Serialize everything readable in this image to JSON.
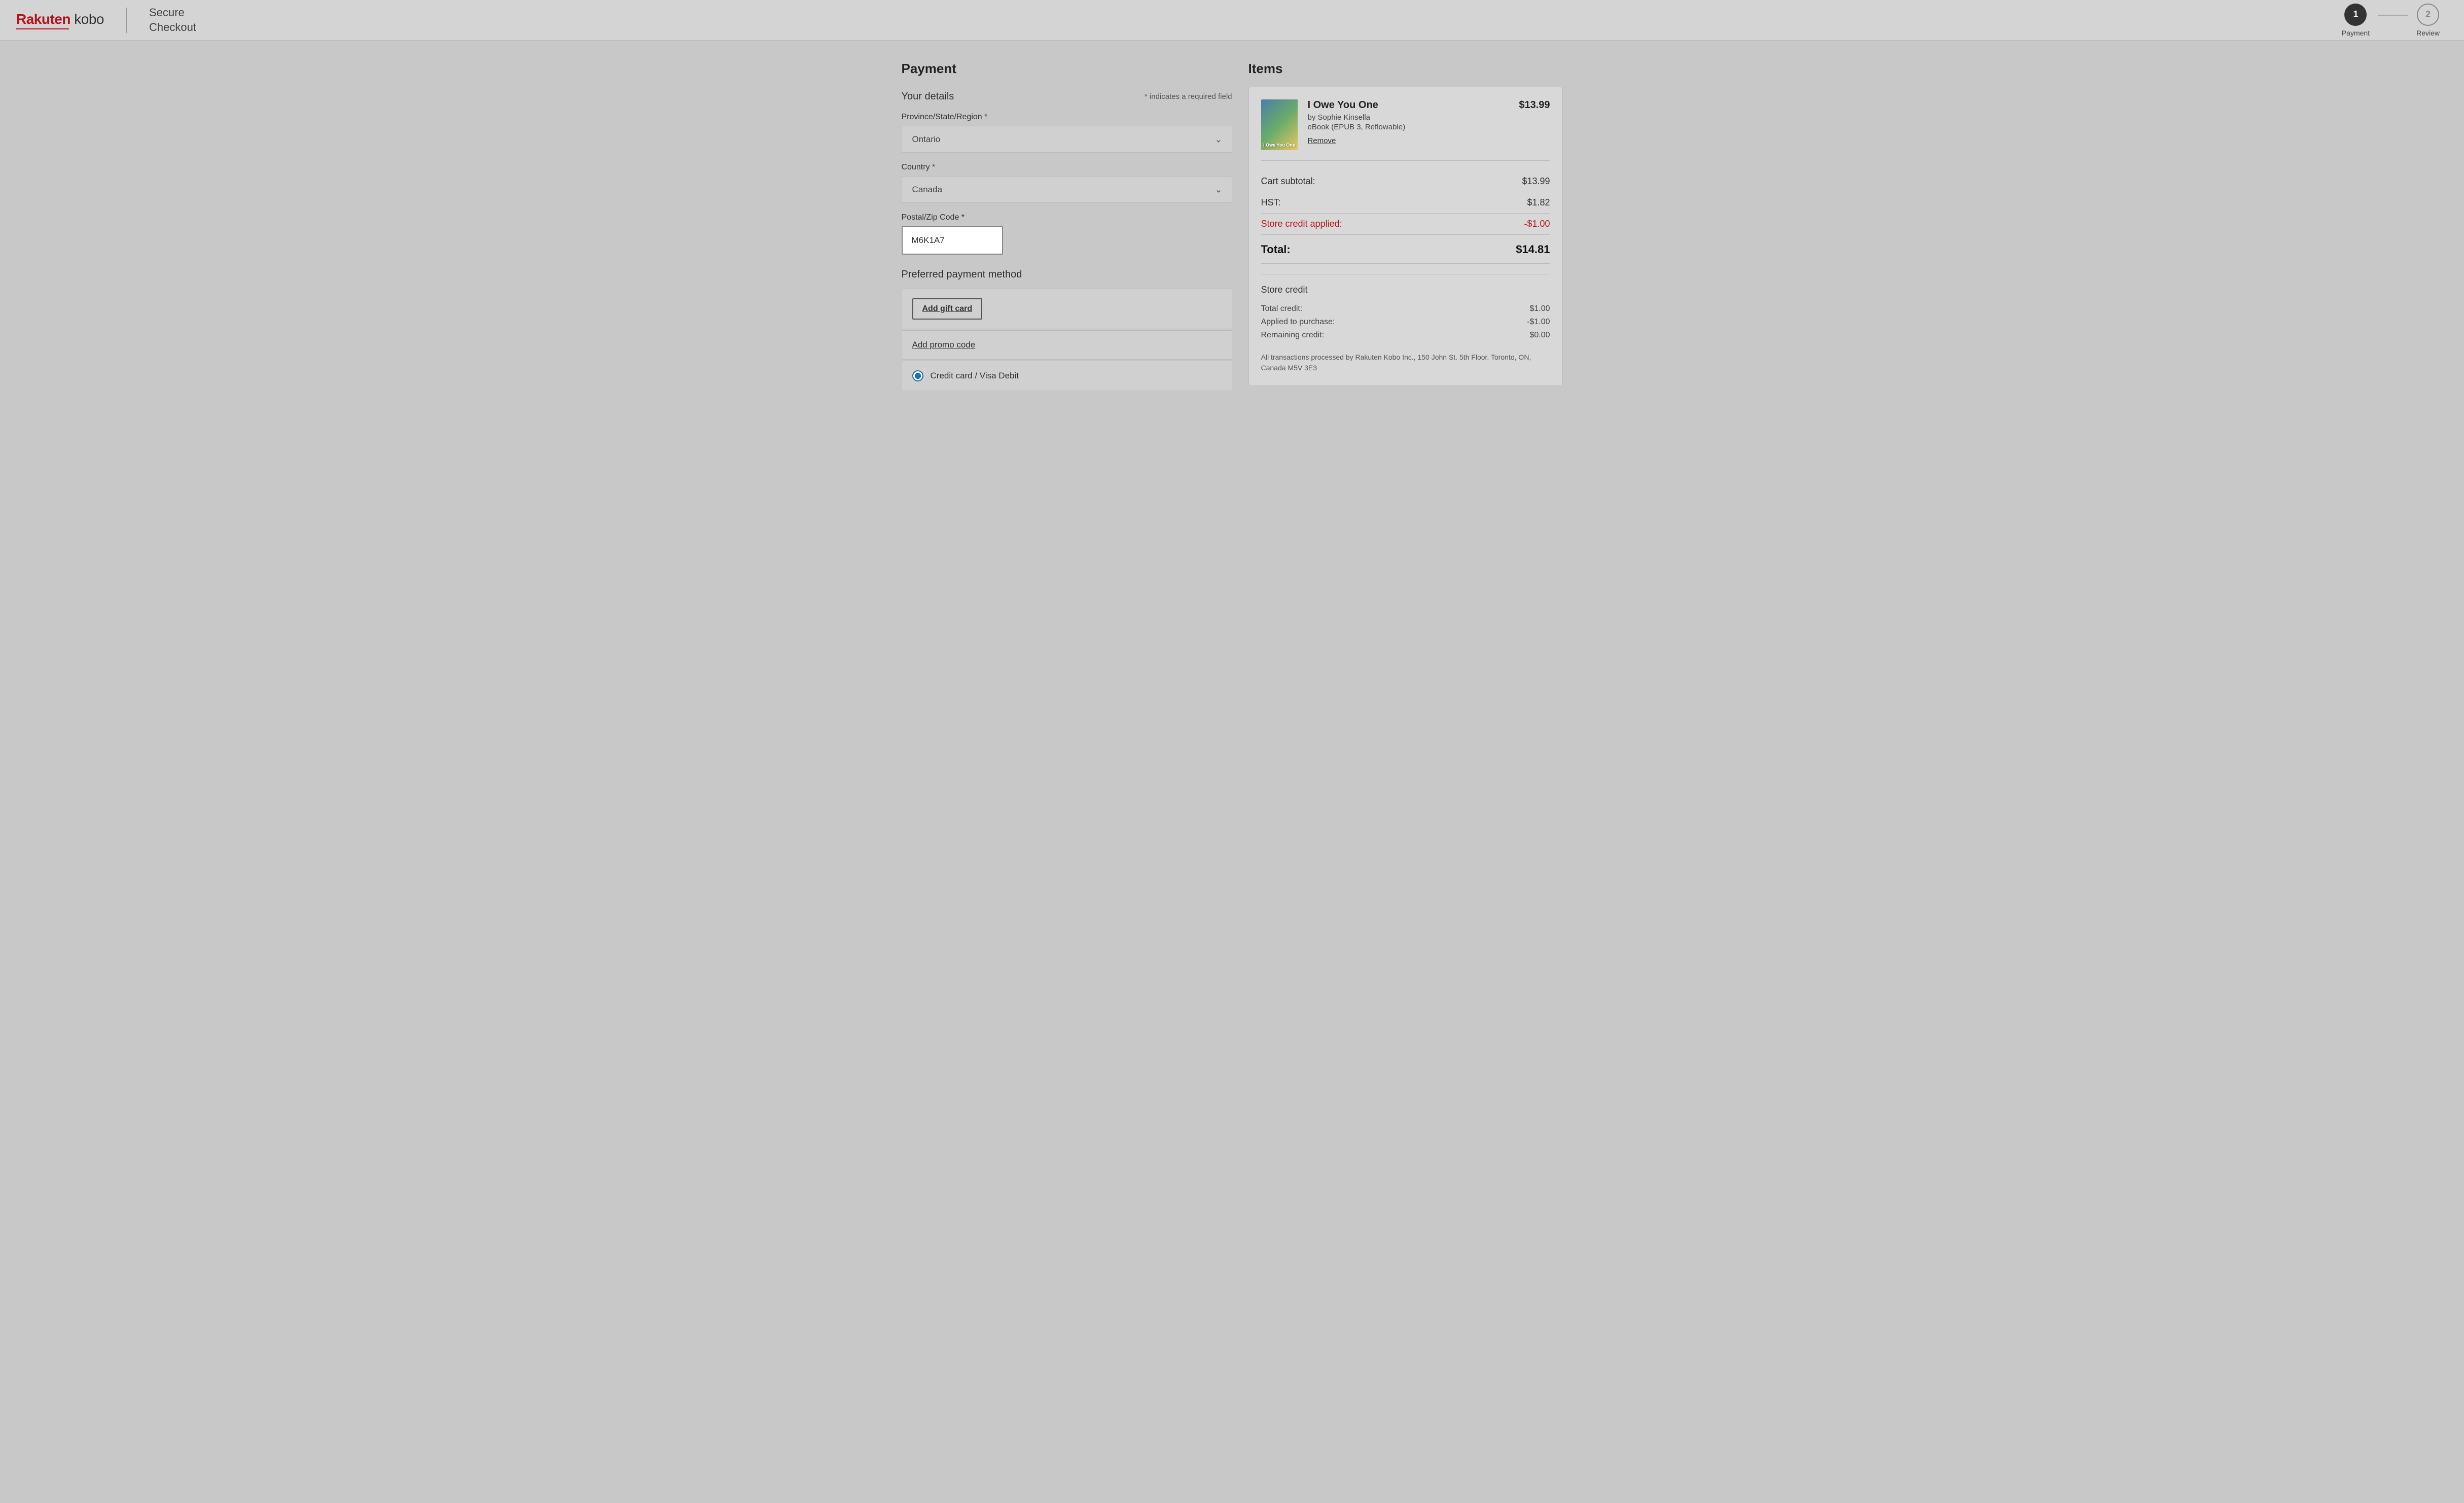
{
  "header": {
    "logo_rakuten": "Rakuten",
    "logo_kobo": "kobo",
    "divider": "",
    "secure_checkout_line1": "Secure",
    "secure_checkout_line2": "Checkout",
    "steps": [
      {
        "number": "1",
        "label": "Payment",
        "active": true
      },
      {
        "number": "2",
        "label": "Review",
        "active": false
      }
    ]
  },
  "payment_section": {
    "title": "Payment",
    "your_details": {
      "label": "Your details",
      "required_note": "* indicates a required field"
    },
    "province_label": "Province/State/Region *",
    "province_value": "Ontario",
    "country_label": "Country *",
    "country_value": "Canada",
    "postal_label": "Postal/Zip Code *",
    "postal_value": "M6K1A7",
    "payment_method_title": "Preferred payment method",
    "add_gift_card_label": "Add gift card",
    "add_promo_label": "Add promo code",
    "credit_card_label": "Credit card / Visa Debit"
  },
  "items_section": {
    "title": "Items",
    "item": {
      "title": "I Owe You One",
      "author": "by Sophie Kinsella",
      "format": "eBook (EPUB 3, Reflowable)",
      "price": "$13.99",
      "remove_label": "Remove",
      "cover_text": "I Owe You One"
    },
    "cart_subtotal_label": "Cart subtotal:",
    "cart_subtotal_value": "$13.99",
    "hst_label": "HST:",
    "hst_value": "$1.82",
    "store_credit_label": "Store credit applied:",
    "store_credit_value": "-$1.00",
    "total_label": "Total:",
    "total_value": "$14.81",
    "store_credit_section": {
      "title": "Store credit",
      "total_credit_label": "Total credit:",
      "total_credit_value": "$1.00",
      "applied_label": "Applied to purchase:",
      "applied_value": "-$1.00",
      "remaining_label": "Remaining credit:",
      "remaining_value": "$0.00"
    },
    "transaction_note": "All transactions processed by Rakuten Kobo Inc., 150 John St. 5th Floor, Toronto, ON, Canada M5V 3E3"
  }
}
